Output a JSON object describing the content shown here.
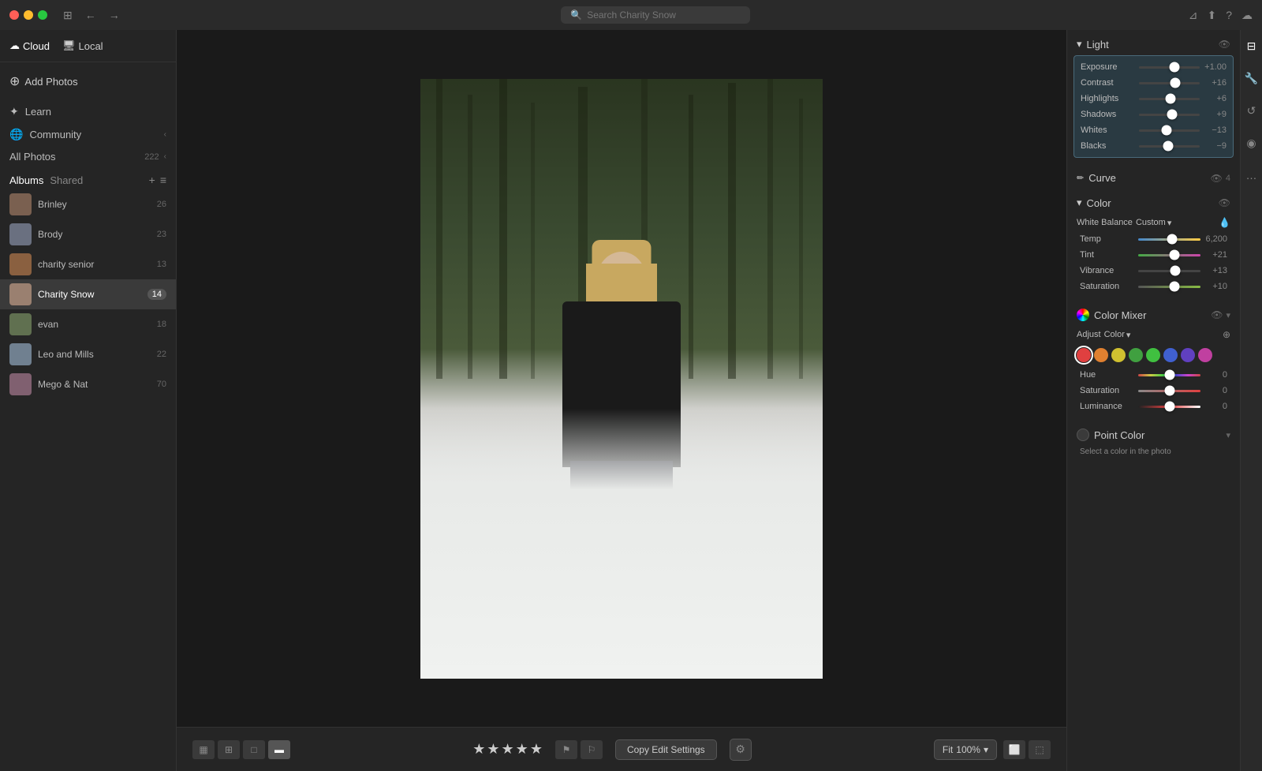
{
  "titlebar": {
    "search_placeholder": "Search Charity Snow",
    "window_control_sidebar": "⊞",
    "back": "←",
    "forward": "→"
  },
  "sidebar": {
    "tab_cloud": "Cloud",
    "tab_local": "Local",
    "add_photos": "Add Photos",
    "nav_learn": "Learn",
    "nav_community": "Community",
    "all_photos": "All Photos",
    "all_photos_count": "222",
    "albums_tab": "Albums",
    "shared_tab": "Shared",
    "albums": [
      {
        "name": "Brinley",
        "count": "26",
        "color": "#7a6050"
      },
      {
        "name": "Brody",
        "count": "23",
        "color": "#6a7080"
      },
      {
        "name": "charity senior",
        "count": "13",
        "color": "#8a6040"
      },
      {
        "name": "Charity Snow",
        "count": "14",
        "active": true,
        "color": "#9a8070"
      },
      {
        "name": "evan",
        "count": "18",
        "color": "#607050"
      },
      {
        "name": "Leo and Mills",
        "count": "22",
        "color": "#708090"
      },
      {
        "name": "Mego & Nat",
        "count": "70",
        "color": "#806070"
      }
    ]
  },
  "toolbar_bottom": {
    "view_modes": [
      "▦",
      "▤",
      "▢",
      "▬"
    ],
    "active_view": 3,
    "stars": [
      "★",
      "★",
      "★",
      "★",
      "★"
    ],
    "flag_labels": [
      "⚑",
      "⚐"
    ],
    "copy_edit": "Copy Edit Settings",
    "settings_icon": "⚙",
    "fit_label": "Fit",
    "zoom_level": "100%",
    "export_icons": [
      "⬜",
      "⬚"
    ]
  },
  "right_panel": {
    "panel_icons": [
      "🔧",
      "🎨",
      "↺",
      "◉",
      "≡"
    ],
    "light": {
      "title": "Light",
      "sliders": [
        {
          "label": "Exposure",
          "value": "+1.00",
          "position": 58
        },
        {
          "label": "Contrast",
          "value": "+16",
          "position": 60
        },
        {
          "label": "Highlights",
          "value": "+6",
          "position": 52
        },
        {
          "label": "Shadows",
          "value": "+9",
          "position": 55
        },
        {
          "label": "Whites",
          "value": "−13",
          "position": 45
        },
        {
          "label": "Blacks",
          "value": "−9",
          "position": 48
        }
      ]
    },
    "curve": {
      "title": "Curve"
    },
    "color": {
      "title": "Color",
      "white_balance": "White Balance",
      "wb_mode": "Custom",
      "sliders": [
        {
          "label": "Temp",
          "value": "6,200",
          "position": 55
        },
        {
          "label": "Tint",
          "value": "+21",
          "position": 58
        },
        {
          "label": "Vibrance",
          "value": "+13",
          "position": 60
        },
        {
          "label": "Saturation",
          "value": "+10",
          "position": 58
        }
      ]
    },
    "color_mixer": {
      "title": "Color Mixer",
      "adjust_label": "Adjust",
      "adjust_value": "Color",
      "colors": [
        {
          "color": "#e04040",
          "active": true
        },
        {
          "color": "#e08030"
        },
        {
          "color": "#d0c030"
        },
        {
          "color": "#40a040"
        },
        {
          "color": "#40c040"
        },
        {
          "color": "#4060d0"
        },
        {
          "color": "#6040c0"
        },
        {
          "color": "#c040a0"
        }
      ],
      "sliders": [
        {
          "label": "Hue",
          "value": "0",
          "position": 50
        },
        {
          "label": "Saturation",
          "value": "0",
          "position": 50
        },
        {
          "label": "Luminance",
          "value": "0",
          "position": 50
        }
      ]
    },
    "point_color": {
      "title": "Point Color",
      "hint": "Select a color in the photo"
    }
  }
}
